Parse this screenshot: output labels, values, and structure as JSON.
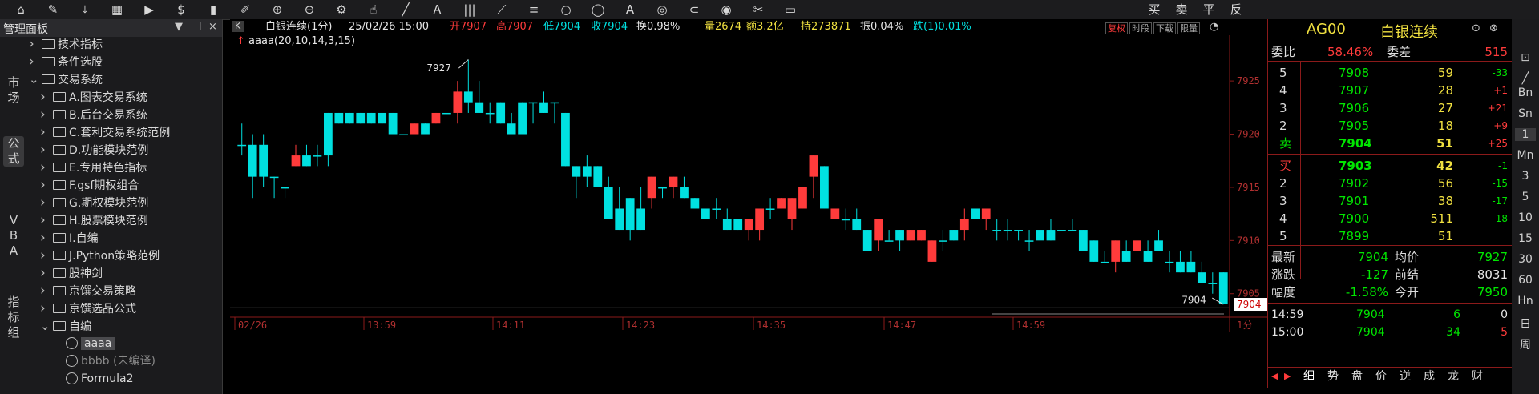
{
  "toolbar": {
    "icons": [
      "home",
      "pointer",
      "download",
      "grid",
      "play",
      "dollar",
      "bar-chart",
      "draw",
      "zoom-in",
      "zoom-out",
      "settings",
      "cursor",
      "line",
      "text",
      "grid-lines",
      "fan",
      "channel",
      "circle",
      "ellipse",
      "text-tool",
      "magnet",
      "lock",
      "eye",
      "brush",
      "box",
      "buy",
      "sell",
      "flat",
      "reverse"
    ],
    "trade_buttons": [
      "买",
      "卖",
      "平",
      "反"
    ]
  },
  "left_panel": {
    "title": "管理面板",
    "pin": "▼",
    "close": "×",
    "vertical_tabs": [
      {
        "label": "市场"
      },
      {
        "label": "公式"
      },
      {
        "label": "VBA"
      },
      {
        "label": "指标组"
      }
    ],
    "tree": [
      {
        "label": "技术指标",
        "level": 1,
        "expanded": false,
        "type": "folder"
      },
      {
        "label": "条件选股",
        "level": 1,
        "expanded": false,
        "type": "folder"
      },
      {
        "label": "交易系统",
        "level": 1,
        "expanded": true,
        "type": "folder"
      },
      {
        "label": "A.图表交易系统",
        "level": 2,
        "expanded": false,
        "type": "folder"
      },
      {
        "label": "B.后台交易系统",
        "level": 2,
        "expanded": false,
        "type": "folder"
      },
      {
        "label": "C.套利交易系统范例",
        "level": 2,
        "expanded": false,
        "type": "folder"
      },
      {
        "label": "D.功能模块范例",
        "level": 2,
        "expanded": false,
        "type": "folder"
      },
      {
        "label": "E.专用特色指标",
        "level": 2,
        "expanded": false,
        "type": "folder"
      },
      {
        "label": "F.gsf期权组合",
        "level": 2,
        "expanded": false,
        "type": "folder"
      },
      {
        "label": "G.期权模块范例",
        "level": 2,
        "expanded": false,
        "type": "folder"
      },
      {
        "label": "H.股票模块范例",
        "level": 2,
        "expanded": false,
        "type": "folder"
      },
      {
        "label": "I.自编",
        "level": 2,
        "expanded": false,
        "type": "folder"
      },
      {
        "label": "J.Python策略范例",
        "level": 2,
        "expanded": false,
        "type": "folder"
      },
      {
        "label": "股神剑",
        "level": 2,
        "expanded": false,
        "type": "folder"
      },
      {
        "label": "京馔交易策略",
        "level": 2,
        "expanded": false,
        "type": "folder"
      },
      {
        "label": "京馔选品公式",
        "level": 2,
        "expanded": false,
        "type": "folder"
      },
      {
        "label": "自编",
        "level": 2,
        "expanded": true,
        "type": "folder"
      },
      {
        "label": "aaaa",
        "level": 3,
        "type": "formula",
        "selected": true
      },
      {
        "label": "bbbb (未编译)",
        "level": 3,
        "type": "formula",
        "dim": true
      },
      {
        "label": "Formula2",
        "level": 3,
        "type": "formula"
      }
    ]
  },
  "chart_header": {
    "mode_label": "K",
    "symbol": "白银连续(1分)",
    "datetime": "25/02/26 15:00",
    "open": "开7907",
    "high": "高7907",
    "low": "低7904",
    "close": "收7904",
    "turnover": "换0.98%",
    "volume": "量2674",
    "amount": "额3.2亿",
    "open_interest": "持273871",
    "amplitude": "振0.04%",
    "change": "跌(1)0.01%",
    "buttons": [
      "复权",
      "时段",
      "下载",
      "限量"
    ],
    "indicator": "aaaa(20,10,14,3,15)"
  },
  "chart_data": {
    "type": "candlestick",
    "period": "1分",
    "ylim": [
      7904,
      7927
    ],
    "y_ticks": [
      7905,
      7910,
      7915,
      7920,
      7925
    ],
    "x_ticks": [
      "02/26",
      "13:59",
      "14:11",
      "14:23",
      "14:35",
      "14:47",
      "14:59"
    ],
    "annotations": [
      {
        "text": "7927",
        "value": 7927
      },
      {
        "text": "7904",
        "value": 7904
      }
    ],
    "last_price_label": "7904",
    "candles": [
      {
        "o": 7919,
        "h": 7921,
        "l": 7918,
        "c": 7919
      },
      {
        "o": 7919,
        "h": 7920,
        "l": 7914,
        "c": 7916
      },
      {
        "o": 7919,
        "h": 7920,
        "l": 7915,
        "c": 7916
      },
      {
        "o": 7916,
        "h": 7916,
        "l": 7914,
        "c": 7916
      },
      {
        "o": 7915,
        "h": 7915,
        "l": 7914,
        "c": 7915
      },
      {
        "o": 7917,
        "h": 7919,
        "l": 7917,
        "c": 7918
      },
      {
        "o": 7918,
        "h": 7919,
        "l": 7917,
        "c": 7917
      },
      {
        "o": 7918,
        "h": 7919,
        "l": 7917,
        "c": 7918
      },
      {
        "o": 7922,
        "h": 7922,
        "l": 7917,
        "c": 7918
      },
      {
        "o": 7922,
        "h": 7922,
        "l": 7921,
        "c": 7921
      },
      {
        "o": 7922,
        "h": 7922,
        "l": 7921,
        "c": 7921
      },
      {
        "o": 7922,
        "h": 7922,
        "l": 7921,
        "c": 7921
      },
      {
        "o": 7922,
        "h": 7922,
        "l": 7921,
        "c": 7921
      },
      {
        "o": 7922,
        "h": 7922,
        "l": 7921,
        "c": 7921
      },
      {
        "o": 7922,
        "h": 7922,
        "l": 7920,
        "c": 7920
      },
      {
        "o": 7920,
        "h": 7920,
        "l": 7920,
        "c": 7920
      },
      {
        "o": 7920,
        "h": 7921,
        "l": 7920,
        "c": 7921
      },
      {
        "o": 7921,
        "h": 7921,
        "l": 7920,
        "c": 7920
      },
      {
        "o": 7921,
        "h": 7922,
        "l": 7921,
        "c": 7922
      },
      {
        "o": 7922,
        "h": 7922,
        "l": 7922,
        "c": 7922
      },
      {
        "o": 7922,
        "h": 7925,
        "l": 7921,
        "c": 7924
      },
      {
        "o": 7924,
        "h": 7927,
        "l": 7922,
        "c": 7923
      },
      {
        "o": 7923,
        "h": 7925,
        "l": 7922,
        "c": 7922
      },
      {
        "o": 7922,
        "h": 7923,
        "l": 7921,
        "c": 7922
      },
      {
        "o": 7923,
        "h": 7923,
        "l": 7921,
        "c": 7921
      },
      {
        "o": 7921,
        "h": 7922,
        "l": 7920,
        "c": 7920
      },
      {
        "o": 7923,
        "h": 7923,
        "l": 7920,
        "c": 7920
      },
      {
        "o": 7923,
        "h": 7923,
        "l": 7921,
        "c": 7923
      },
      {
        "o": 7923,
        "h": 7924,
        "l": 7922,
        "c": 7922
      },
      {
        "o": 7923,
        "h": 7923,
        "l": 7921,
        "c": 7923
      },
      {
        "o": 7922,
        "h": 7922,
        "l": 7917,
        "c": 7917
      },
      {
        "o": 7917,
        "h": 7917,
        "l": 7914,
        "c": 7916
      },
      {
        "o": 7917,
        "h": 7918,
        "l": 7915,
        "c": 7916
      },
      {
        "o": 7917,
        "h": 7917,
        "l": 7915,
        "c": 7915
      },
      {
        "o": 7915,
        "h": 7916,
        "l": 7912,
        "c": 7912
      },
      {
        "o": 7913,
        "h": 7915,
        "l": 7911,
        "c": 7911
      },
      {
        "o": 7914,
        "h": 7914,
        "l": 7910,
        "c": 7911
      },
      {
        "o": 7913,
        "h": 7915,
        "l": 7911,
        "c": 7911
      },
      {
        "o": 7914,
        "h": 7916,
        "l": 7913,
        "c": 7916
      },
      {
        "o": 7915,
        "h": 7915,
        "l": 7914,
        "c": 7915
      },
      {
        "o": 7915,
        "h": 7916,
        "l": 7914,
        "c": 7916
      },
      {
        "o": 7915,
        "h": 7916,
        "l": 7914,
        "c": 7914
      },
      {
        "o": 7914,
        "h": 7914,
        "l": 7913,
        "c": 7913
      },
      {
        "o": 7913,
        "h": 7913,
        "l": 7912,
        "c": 7912
      },
      {
        "o": 7913,
        "h": 7914,
        "l": 7912,
        "c": 7913
      },
      {
        "o": 7912,
        "h": 7913,
        "l": 7911,
        "c": 7911
      },
      {
        "o": 7912,
        "h": 7912,
        "l": 7911,
        "c": 7911
      },
      {
        "o": 7911,
        "h": 7912,
        "l": 7910,
        "c": 7912
      },
      {
        "o": 7911,
        "h": 7913,
        "l": 7910,
        "c": 7913
      },
      {
        "o": 7913,
        "h": 7914,
        "l": 7912,
        "c": 7913
      },
      {
        "o": 7913,
        "h": 7914,
        "l": 7913,
        "c": 7914
      },
      {
        "o": 7912,
        "h": 7914,
        "l": 7911,
        "c": 7914
      },
      {
        "o": 7913,
        "h": 7915,
        "l": 7913,
        "c": 7915
      },
      {
        "o": 7916,
        "h": 7918,
        "l": 7914,
        "c": 7918
      },
      {
        "o": 7917,
        "h": 7917,
        "l": 7913,
        "c": 7913
      },
      {
        "o": 7912,
        "h": 7913,
        "l": 7912,
        "c": 7913
      },
      {
        "o": 7912,
        "h": 7913,
        "l": 7911,
        "c": 7912
      },
      {
        "o": 7912,
        "h": 7913,
        "l": 7911,
        "c": 7911
      },
      {
        "o": 7911,
        "h": 7911,
        "l": 7909,
        "c": 7909
      },
      {
        "o": 7910,
        "h": 7912,
        "l": 7909,
        "c": 7912
      },
      {
        "o": 7910,
        "h": 7911,
        "l": 7910,
        "c": 7910
      },
      {
        "o": 7911,
        "h": 7911,
        "l": 7909,
        "c": 7910
      },
      {
        "o": 7910,
        "h": 7911,
        "l": 7910,
        "c": 7911
      },
      {
        "o": 7910,
        "h": 7911,
        "l": 7910,
        "c": 7911
      },
      {
        "o": 7908,
        "h": 7910,
        "l": 7908,
        "c": 7910
      },
      {
        "o": 7910,
        "h": 7911,
        "l": 7909,
        "c": 7910
      },
      {
        "o": 7911,
        "h": 7911,
        "l": 7910,
        "c": 7910
      },
      {
        "o": 7911,
        "h": 7913,
        "l": 7910,
        "c": 7912
      },
      {
        "o": 7913,
        "h": 7913,
        "l": 7912,
        "c": 7912
      },
      {
        "o": 7912,
        "h": 7913,
        "l": 7911,
        "c": 7913
      },
      {
        "o": 7911,
        "h": 7912,
        "l": 7910,
        "c": 7911
      },
      {
        "o": 7911,
        "h": 7912,
        "l": 7910,
        "c": 7911
      },
      {
        "o": 7911,
        "h": 7911,
        "l": 7910,
        "c": 7911
      },
      {
        "o": 7910,
        "h": 7911,
        "l": 7909,
        "c": 7910
      },
      {
        "o": 7911,
        "h": 7911,
        "l": 7910,
        "c": 7910
      },
      {
        "o": 7911,
        "h": 7912,
        "l": 7910,
        "c": 7910
      },
      {
        "o": 7911,
        "h": 7911,
        "l": 7911,
        "c": 7911
      },
      {
        "o": 7911,
        "h": 7912,
        "l": 7911,
        "c": 7911
      },
      {
        "o": 7911,
        "h": 7911,
        "l": 7909,
        "c": 7909
      },
      {
        "o": 7910,
        "h": 7910,
        "l": 7908,
        "c": 7908
      },
      {
        "o": 7908,
        "h": 7909,
        "l": 7908,
        "c": 7908
      },
      {
        "o": 7908,
        "h": 7910,
        "l": 7907,
        "c": 7910
      },
      {
        "o": 7909,
        "h": 7910,
        "l": 7908,
        "c": 7908
      },
      {
        "o": 7909,
        "h": 7910,
        "l": 7909,
        "c": 7910
      },
      {
        "o": 7909,
        "h": 7910,
        "l": 7908,
        "c": 7908
      },
      {
        "o": 7910,
        "h": 7911,
        "l": 7909,
        "c": 7909
      },
      {
        "o": 7908,
        "h": 7909,
        "l": 7907,
        "c": 7908
      },
      {
        "o": 7908,
        "h": 7909,
        "l": 7907,
        "c": 7907
      },
      {
        "o": 7908,
        "h": 7909,
        "l": 7907,
        "c": 7907
      },
      {
        "o": 7907,
        "h": 7908,
        "l": 7906,
        "c": 7906
      },
      {
        "o": 7906,
        "h": 7907,
        "l": 7905,
        "c": 7906
      },
      {
        "o": 7907,
        "h": 7907,
        "l": 7904,
        "c": 7904
      }
    ]
  },
  "quote_panel": {
    "symbol": "AG00",
    "name": "白银连续",
    "weibi_label": "委比",
    "weibi": "58.46%",
    "weicha_label": "委差",
    "weicha": "515",
    "sell_levels": [
      {
        "level": "5",
        "price": "7908",
        "volume": "59",
        "change": "-33"
      },
      {
        "level": "4",
        "price": "7907",
        "volume": "28",
        "change": "+1"
      },
      {
        "level": "3",
        "price": "7906",
        "volume": "27",
        "change": "+21"
      },
      {
        "level": "2",
        "price": "7905",
        "volume": "18",
        "change": "+9"
      },
      {
        "level": "卖",
        "price": "7904",
        "volume": "51",
        "change": "+25"
      }
    ],
    "buy_levels": [
      {
        "level": "买",
        "price": "7903",
        "volume": "42",
        "change": "-1"
      },
      {
        "level": "2",
        "price": "7902",
        "volume": "56",
        "change": "-15"
      },
      {
        "level": "3",
        "price": "7901",
        "volume": "38",
        "change": "-17"
      },
      {
        "level": "4",
        "price": "7900",
        "volume": "511",
        "change": "-18"
      },
      {
        "level": "5",
        "price": "7899",
        "volume": "51",
        "change": ""
      }
    ],
    "stats": [
      {
        "label": "最新",
        "value": "7904",
        "label2": "均价",
        "value2": "7927"
      },
      {
        "label": "涨跌",
        "value": "-127",
        "label2": "前结",
        "value2": "8031"
      },
      {
        "label": "幅度",
        "value": "-1.58%",
        "label2": "今开",
        "value2": "7950"
      }
    ],
    "ticks": [
      {
        "time": "14:59",
        "price": "7904",
        "vol": "6",
        "oi": "0"
      },
      {
        "time": "15:00",
        "price": "7904",
        "vol": "34",
        "oi": "5"
      }
    ],
    "bottom_tabs": [
      "细",
      "势",
      "盘",
      "价",
      "逆",
      "成",
      "龙",
      "财"
    ]
  },
  "right_sidebar": [
    "Bn",
    "Sn",
    "1",
    "Mn",
    "3",
    "5",
    "10",
    "15",
    "30",
    "60",
    "Hn",
    "日",
    "周"
  ],
  "colors": {
    "up": "#ff3b3b",
    "down": "#00e0e0",
    "green": "#00e600",
    "yellow": "#f0e040",
    "axis": "#8b1a1a"
  }
}
